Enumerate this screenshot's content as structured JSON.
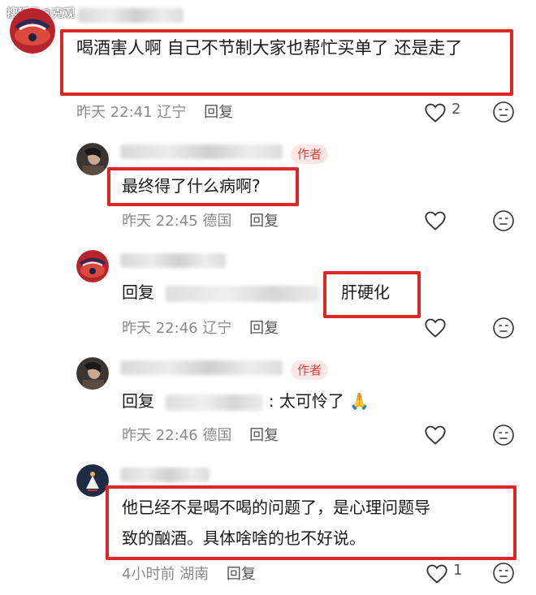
{
  "watermark": "搜狐号@克观",
  "comments": [
    {
      "text": "喝酒害人啊 自己不节制大家也帮忙买单了 还是走了",
      "time": "昨天 22:41",
      "location": "辽宁",
      "reply_label": "回复",
      "likes": "2"
    },
    {
      "author_badge": "作者",
      "text": "最终得了什么病啊?",
      "time": "昨天 22:45",
      "location": "德国",
      "reply_label": "回复"
    },
    {
      "reply_prefix": "回复",
      "text": "肝硬化",
      "time": "昨天 22:46",
      "location": "辽宁",
      "reply_label": "回复"
    },
    {
      "author_badge": "作者",
      "reply_prefix": "回复",
      "text": ": 太可怜了",
      "emoji": "🙏",
      "time": "昨天 22:46",
      "location": "德国",
      "reply_label": "回复"
    },
    {
      "text_line1": "他已经不是喝不喝的问题了，是心理问题导",
      "text_line2": "致的酗酒。具体啥啥的也不好说。",
      "time": "4小时前",
      "location": "湖南",
      "reply_label": "回复",
      "likes": "1"
    }
  ],
  "colors": {
    "highlight_box": "#e02525",
    "author_badge": "#e0413c",
    "meta_text": "#8a8a8a"
  },
  "icons": [
    "heart-outline-icon",
    "neutral-face-icon",
    "praying-hands-emoji"
  ]
}
